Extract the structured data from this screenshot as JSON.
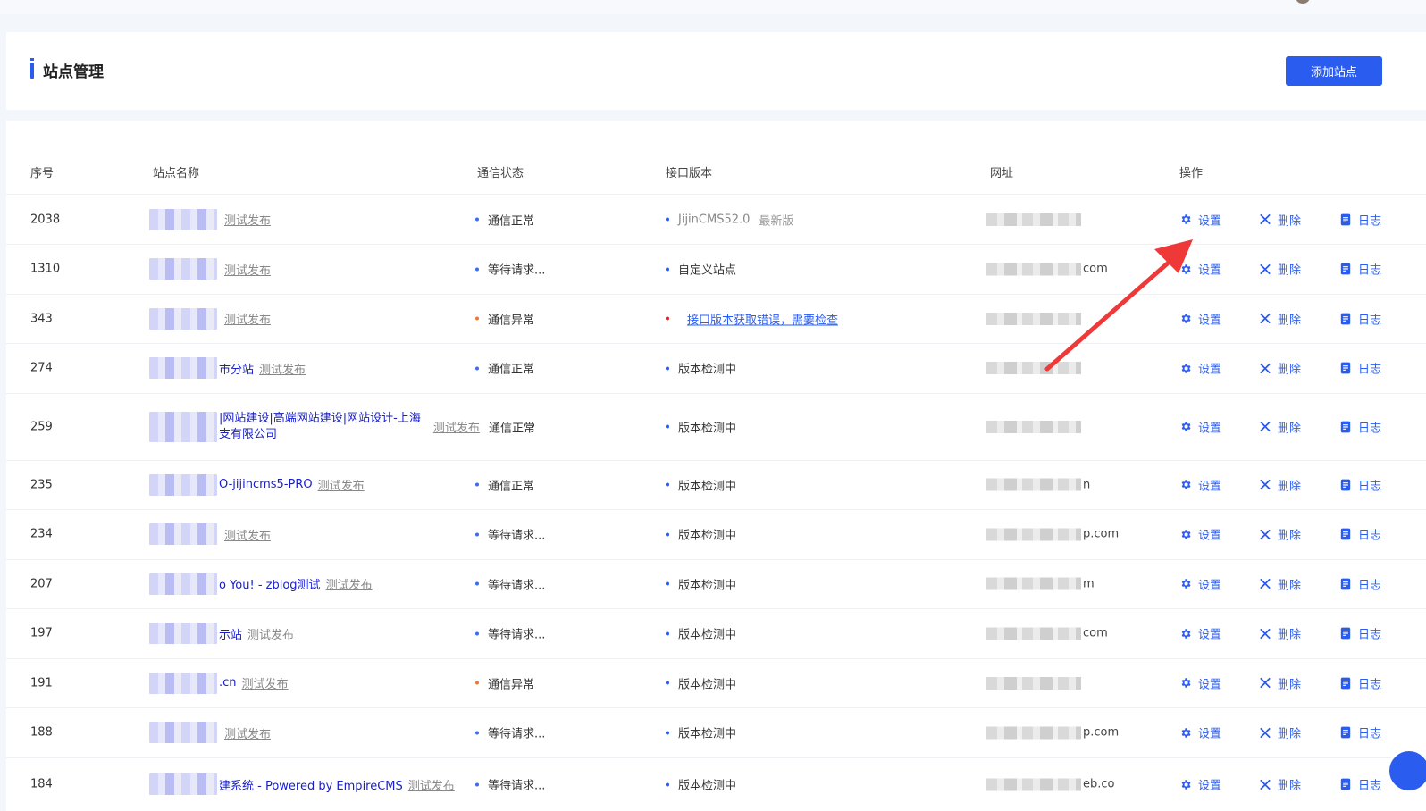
{
  "page": {
    "title": "站点管理",
    "add_button": "添加站点"
  },
  "table": {
    "headers": {
      "id": "序号",
      "name": "站点名称",
      "status": "通信状态",
      "version": "接口版本",
      "url": "网址",
      "actions": "操作"
    },
    "action_labels": {
      "settings": "设置",
      "delete": "删除",
      "log": "日志"
    },
    "test_publish_label": "测试发布",
    "rows": [
      {
        "id": "2038",
        "name_visible": "",
        "status": "通信正常",
        "status_color": "#3b6cf5",
        "version": "JijinCMS52.0",
        "version_badge": "最新版",
        "version_kind": "latest",
        "url_suffix": ""
      },
      {
        "id": "1310",
        "name_visible": "",
        "status": "等待请求...",
        "status_color": "#3b6cf5",
        "version": "自定义站点",
        "version_badge": "",
        "version_kind": "normal",
        "url_suffix": "com"
      },
      {
        "id": "343",
        "name_visible": "",
        "status": "通信异常",
        "status_color": "#f07a2a",
        "version": "接口版本获取错误，需要检查",
        "version_badge": "",
        "version_kind": "error",
        "url_suffix": ""
      },
      {
        "id": "274",
        "name_visible": "市分站",
        "status": "通信正常",
        "status_color": "#3b6cf5",
        "version": "版本检测中",
        "version_badge": "",
        "version_kind": "normal",
        "url_suffix": ""
      },
      {
        "id": "259",
        "name_visible": "|网站建设|高端网站建设|网站设计-上海",
        "name_visible_2": "支有限公司",
        "status": "通信正常",
        "status_color": "#3b6cf5",
        "version": "版本检测中",
        "version_badge": "",
        "version_kind": "normal",
        "url_suffix": ""
      },
      {
        "id": "235",
        "name_visible": "O-jijincms5-PRO",
        "status": "通信正常",
        "status_color": "#3b6cf5",
        "version": "版本检测中",
        "version_badge": "",
        "version_kind": "normal",
        "url_suffix": "n"
      },
      {
        "id": "234",
        "name_visible": "",
        "status": "等待请求...",
        "status_color": "#3b6cf5",
        "version": "版本检测中",
        "version_badge": "",
        "version_kind": "normal",
        "url_suffix": "p.com"
      },
      {
        "id": "207",
        "name_visible": "o You! - zblog测试",
        "status": "等待请求...",
        "status_color": "#3b6cf5",
        "version": "版本检测中",
        "version_badge": "",
        "version_kind": "normal",
        "url_suffix": "m"
      },
      {
        "id": "197",
        "name_visible": "示站",
        "status": "等待请求...",
        "status_color": "#3b6cf5",
        "version": "版本检测中",
        "version_badge": "",
        "version_kind": "normal",
        "url_suffix": "com"
      },
      {
        "id": "191",
        "name_visible": ".cn",
        "status": "通信异常",
        "status_color": "#f07a2a",
        "version": "版本检测中",
        "version_badge": "",
        "version_kind": "normal",
        "url_suffix": ""
      },
      {
        "id": "188",
        "name_visible": "",
        "status": "等待请求...",
        "status_color": "#3b6cf5",
        "version": "版本检测中",
        "version_badge": "",
        "version_kind": "normal",
        "url_suffix": "p.com"
      },
      {
        "id": "184",
        "name_visible": "建系统 - Powered by EmpireCMS",
        "status": "等待请求...",
        "status_color": "#3b6cf5",
        "version": "版本检测中",
        "version_badge": "",
        "version_kind": "normal",
        "url_suffix": "eb.co"
      }
    ]
  },
  "colors": {
    "accent": "#2b5cf0",
    "error_dot": "#e8202a",
    "annotation_arrow": "#ef3838"
  },
  "icons": {
    "settings": "gear-icon",
    "delete": "close-icon",
    "log": "document-icon"
  }
}
